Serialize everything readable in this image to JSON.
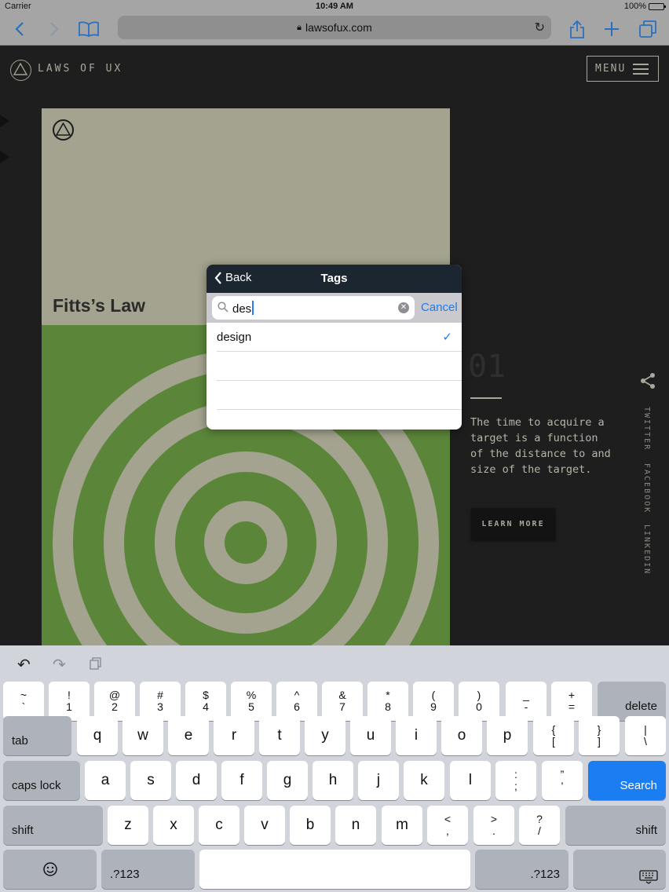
{
  "status_bar": {
    "carrier": "Carrier",
    "time": "10:49 AM",
    "battery": "100%"
  },
  "browser": {
    "url": "lawsofux.com"
  },
  "site": {
    "name": "LAWS OF UX",
    "menu_label": "MENU",
    "law_title": "Fitts’s Law",
    "law_number": "01",
    "law_description": "The time to acquire a target is a function of the distance to and size of the target.",
    "learn_more": "LEARN MORE",
    "social": [
      "TWITTER",
      "FACEBOOK",
      "LINKEDIN"
    ]
  },
  "colors": {
    "card_top": "#a3a38f",
    "card_bottom": "#5b8639",
    "accent": "#1a7df2",
    "popover_header": "#1c2630"
  },
  "popover": {
    "back_label": "Back",
    "title": "Tags",
    "search_value": "des",
    "cancel_label": "Cancel",
    "results": [
      {
        "label": "design",
        "selected": true
      }
    ]
  },
  "keyboard": {
    "number_row": [
      {
        "top": "~",
        "bottom": "`"
      },
      {
        "top": "!",
        "bottom": "1"
      },
      {
        "top": "@",
        "bottom": "2"
      },
      {
        "top": "#",
        "bottom": "3"
      },
      {
        "top": "$",
        "bottom": "4"
      },
      {
        "top": "%",
        "bottom": "5"
      },
      {
        "top": "^",
        "bottom": "6"
      },
      {
        "top": "&",
        "bottom": "7"
      },
      {
        "top": "*",
        "bottom": "8"
      },
      {
        "top": "(",
        "bottom": "9"
      },
      {
        "top": ")",
        "bottom": "0"
      },
      {
        "top": "_",
        "bottom": "-"
      },
      {
        "top": "+",
        "bottom": "="
      }
    ],
    "delete": "delete",
    "tab": "tab",
    "row_q": [
      "q",
      "w",
      "e",
      "r",
      "t",
      "y",
      "u",
      "i",
      "o",
      "p"
    ],
    "row_q_sym": [
      {
        "top": "{",
        "bottom": "["
      },
      {
        "top": "}",
        "bottom": "]"
      },
      {
        "top": "|",
        "bottom": "\\"
      }
    ],
    "caps_lock": "caps lock",
    "row_a": [
      "a",
      "s",
      "d",
      "f",
      "g",
      "h",
      "j",
      "k",
      "l"
    ],
    "row_a_sym": [
      {
        "top": ":",
        "bottom": ";"
      },
      {
        "top": "”",
        "bottom": "’"
      }
    ],
    "search": "Search",
    "shift": "shift",
    "row_z": [
      "z",
      "x",
      "c",
      "v",
      "b",
      "n",
      "m"
    ],
    "row_z_sym": [
      {
        "top": "<",
        "bottom": ","
      },
      {
        "top": ">",
        "bottom": "."
      },
      {
        "top": "?",
        "bottom": "/"
      }
    ],
    "numbers_label": ".?123",
    "icons": [
      "undo-icon",
      "redo-icon",
      "paste-icon",
      "emoji-icon",
      "keyboard-dismiss-icon"
    ]
  }
}
